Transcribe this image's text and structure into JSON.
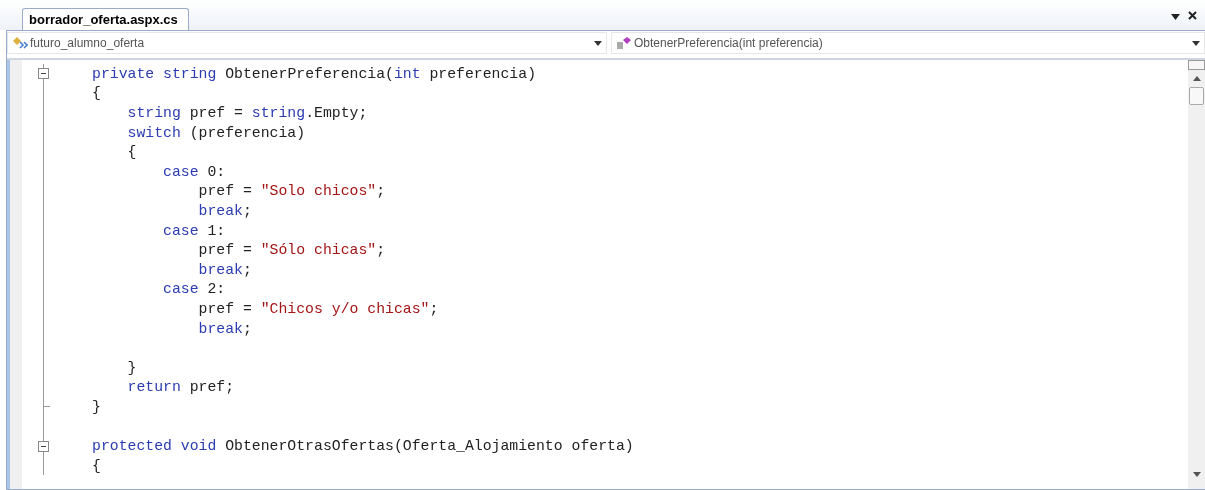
{
  "tabs": [
    {
      "label": "borrador_oferta.aspx.cs",
      "selected": true
    }
  ],
  "navigation": {
    "type_dropdown": "futuro_alumno_oferta",
    "member_dropdown": "ObtenerPreferencia(int preferencia)"
  },
  "code_lines": [
    {
      "collapsible": true,
      "tokens": [
        {
          "kind": "keyword",
          "text": "private"
        },
        {
          "kind": "keyword",
          "text": " string"
        },
        {
          "kind": "plain",
          "text": " ObtenerPreferencia("
        },
        {
          "kind": "keyword",
          "text": "int"
        },
        {
          "kind": "plain",
          "text": " preferencia)"
        }
      ]
    },
    {
      "tokens": [
        {
          "kind": "plain",
          "text": "{"
        }
      ]
    },
    {
      "tokens": [
        {
          "kind": "keyword",
          "text": "    string"
        },
        {
          "kind": "plain",
          "text": " pref = "
        },
        {
          "kind": "keyword",
          "text": "string"
        },
        {
          "kind": "plain",
          "text": ".Empty;"
        }
      ]
    },
    {
      "tokens": [
        {
          "kind": "keyword",
          "text": "    switch"
        },
        {
          "kind": "plain",
          "text": " (preferencia)"
        }
      ]
    },
    {
      "tokens": [
        {
          "kind": "plain",
          "text": "    {"
        }
      ]
    },
    {
      "tokens": [
        {
          "kind": "keyword",
          "text": "        case"
        },
        {
          "kind": "plain",
          "text": " 0:"
        }
      ]
    },
    {
      "tokens": [
        {
          "kind": "plain",
          "text": "            pref = "
        },
        {
          "kind": "string",
          "text": "\"Solo chicos\""
        },
        {
          "kind": "plain",
          "text": ";"
        }
      ]
    },
    {
      "tokens": [
        {
          "kind": "keyword",
          "text": "            break"
        },
        {
          "kind": "plain",
          "text": ";"
        }
      ]
    },
    {
      "tokens": [
        {
          "kind": "keyword",
          "text": "        case"
        },
        {
          "kind": "plain",
          "text": " 1:"
        }
      ]
    },
    {
      "tokens": [
        {
          "kind": "plain",
          "text": "            pref = "
        },
        {
          "kind": "string",
          "text": "\"Sólo chicas\""
        },
        {
          "kind": "plain",
          "text": ";"
        }
      ]
    },
    {
      "tokens": [
        {
          "kind": "keyword",
          "text": "            break"
        },
        {
          "kind": "plain",
          "text": ";"
        }
      ]
    },
    {
      "tokens": [
        {
          "kind": "keyword",
          "text": "        case"
        },
        {
          "kind": "plain",
          "text": " 2:"
        }
      ]
    },
    {
      "tokens": [
        {
          "kind": "plain",
          "text": "            pref = "
        },
        {
          "kind": "string",
          "text": "\"Chicos y/o chicas\""
        },
        {
          "kind": "plain",
          "text": ";"
        }
      ]
    },
    {
      "tokens": [
        {
          "kind": "keyword",
          "text": "            break"
        },
        {
          "kind": "plain",
          "text": ";"
        }
      ]
    },
    {
      "kind": "blank"
    },
    {
      "tokens": [
        {
          "kind": "plain",
          "text": "    }"
        }
      ]
    },
    {
      "tokens": [
        {
          "kind": "keyword",
          "text": "    return"
        },
        {
          "kind": "plain",
          "text": " pref;"
        }
      ]
    },
    {
      "fold_end": true,
      "tokens": [
        {
          "kind": "plain",
          "text": "}"
        }
      ]
    },
    {
      "kind": "blank"
    },
    {
      "collapsible": true,
      "tokens": [
        {
          "kind": "keyword",
          "text": "protected"
        },
        {
          "kind": "keyword",
          "text": " void"
        },
        {
          "kind": "plain",
          "text": " ObtenerOtrasOfertas(Oferta_Alojamiento oferta)"
        }
      ]
    },
    {
      "tokens": [
        {
          "kind": "plain",
          "text": "{"
        }
      ]
    }
  ]
}
